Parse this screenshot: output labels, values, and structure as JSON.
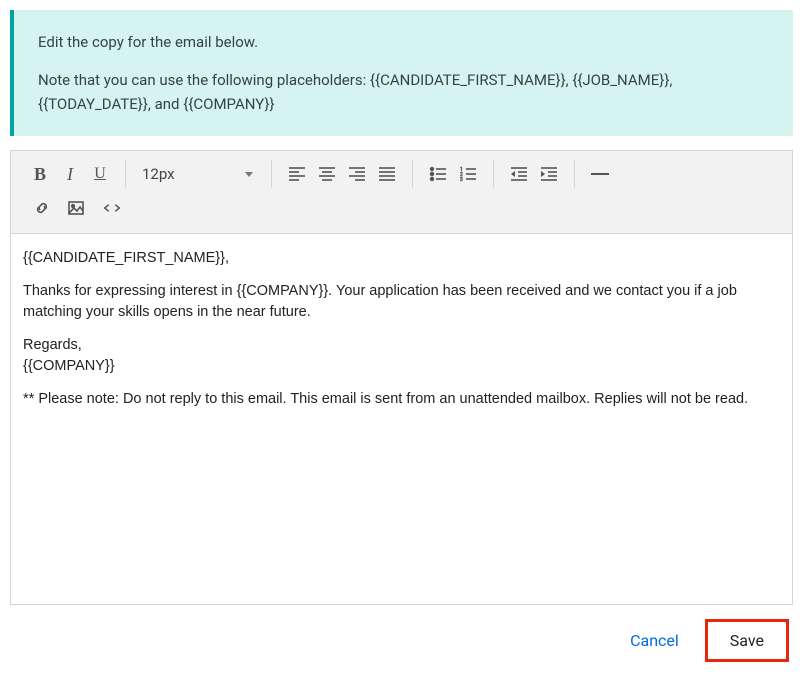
{
  "banner": {
    "line1": "Edit the copy for the email below.",
    "line2": "Note that you can use the following placeholders: {{CANDIDATE_FIRST_NAME}}, {{JOB_NAME}}, {{TODAY_DATE}}, and {{COMPANY}}"
  },
  "toolbar": {
    "font_size": "12px"
  },
  "email": {
    "greeting": "{{CANDIDATE_FIRST_NAME}},",
    "body": "Thanks for expressing interest in {{COMPANY}}. Your application has been received and we contact you if a job matching your skills opens in the near future.",
    "signoff1": "Regards,",
    "signoff2": "{{COMPANY}}",
    "footer": "** Please note: Do not reply to this email. This email is sent from an unattended mailbox. Replies will not be read."
  },
  "actions": {
    "cancel": "Cancel",
    "save": "Save"
  }
}
